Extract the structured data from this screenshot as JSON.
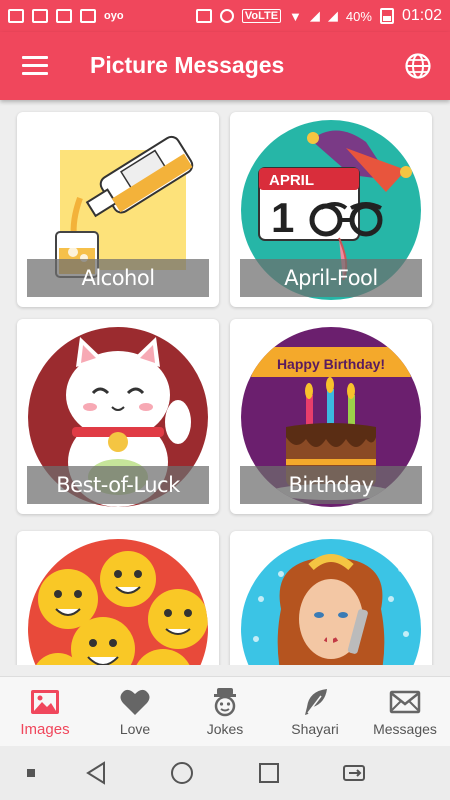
{
  "status_bar": {
    "carrier_text": "oyo",
    "volte": "VoLTE",
    "battery": "40%",
    "time": "01:02"
  },
  "app_bar": {
    "title": "Picture Messages",
    "menu_icon": "hamburger-menu-icon",
    "language_icon": "globe-icon"
  },
  "categories": [
    {
      "label": "Alcohol"
    },
    {
      "label": "April-Fool"
    },
    {
      "label": "Best-of-Luck"
    },
    {
      "label": "Birthday"
    },
    {
      "label": "",
      "art": "emoji-faces"
    },
    {
      "label": "",
      "art": "woman-portrait"
    }
  ],
  "april_fool_art": {
    "month": "APRIL",
    "day": "1"
  },
  "birthday_art": {
    "banner": "Happy Birthday!"
  },
  "bottom_nav": [
    {
      "label": "Images",
      "icon": "image-icon",
      "active": true
    },
    {
      "label": "Love",
      "icon": "heart-icon",
      "active": false
    },
    {
      "label": "Jokes",
      "icon": "face-icon",
      "active": false
    },
    {
      "label": "Shayari",
      "icon": "feather-icon",
      "active": false
    },
    {
      "label": "Messages",
      "icon": "envelope-icon",
      "active": false
    }
  ],
  "colors": {
    "primary": "#f0475c",
    "active_tab": "#f0475c",
    "inactive_tab": "#555555"
  }
}
